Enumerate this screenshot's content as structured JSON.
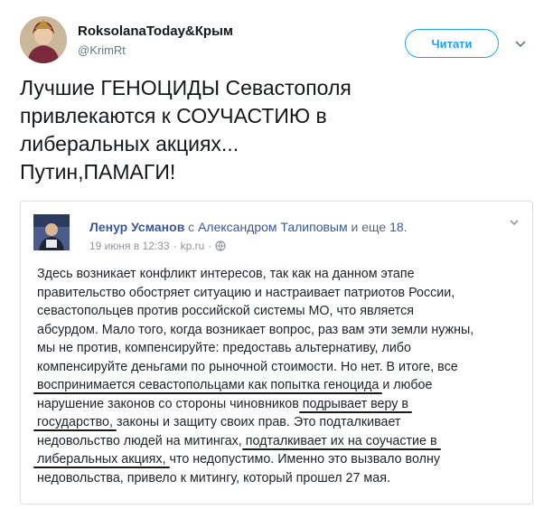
{
  "header": {
    "display_name": "RoksolanaToday&Крым",
    "handle": "@KrimRt",
    "follow_label": "Читати"
  },
  "tweet": {
    "text": "Лучшие ГЕНОЦИДЫ Севастополя\nпривлекаются к СОУЧАСТИЮ в\nлиберальных акциях...\nПутин,ПАМАГИ!"
  },
  "fb_post": {
    "author": "Ленур Усманов",
    "with_word": " с ",
    "tagged": "Александром Талиповым",
    "and_more": " и еще ",
    "more_count": "18",
    "date": "19 июня в 12:33",
    "dot": "·",
    "source": "kp.ru",
    "dot2": "·",
    "lines": [
      [
        "Здесь возникает конфликт интересов, так как на данном этапе"
      ],
      [
        "правительство обостряет ситуацию и настраивает патриотов России,"
      ],
      [
        "севастопольцев против российской системы МО, что является"
      ],
      [
        "абсурдом. Мало того, когда возникает вопрос, раз вам эти земли нужны,"
      ],
      [
        "мы не против, компенсируйте: предоставь альтернативу, либо"
      ],
      [
        "компенсируйте деньгами по рыночной стоимости. Но нет. В итоге, все"
      ],
      [
        "воспринимается севастопольцами как попытка геноцида",
        " и любое"
      ],
      [
        "нарушение законов со стороны чиновников ",
        "подрывает веру в"
      ],
      [
        "государство,",
        " законы и защиту своих прав. Это подталкивает"
      ],
      [
        "недовольство людей на митингах, ",
        "подталкивает их на соучастие в"
      ],
      [
        "либеральных акциях,",
        " что недопустимо. Именно это вызвало волну"
      ],
      [
        "недовольства, привело к митингу, который прошел 27 мая."
      ]
    ]
  }
}
